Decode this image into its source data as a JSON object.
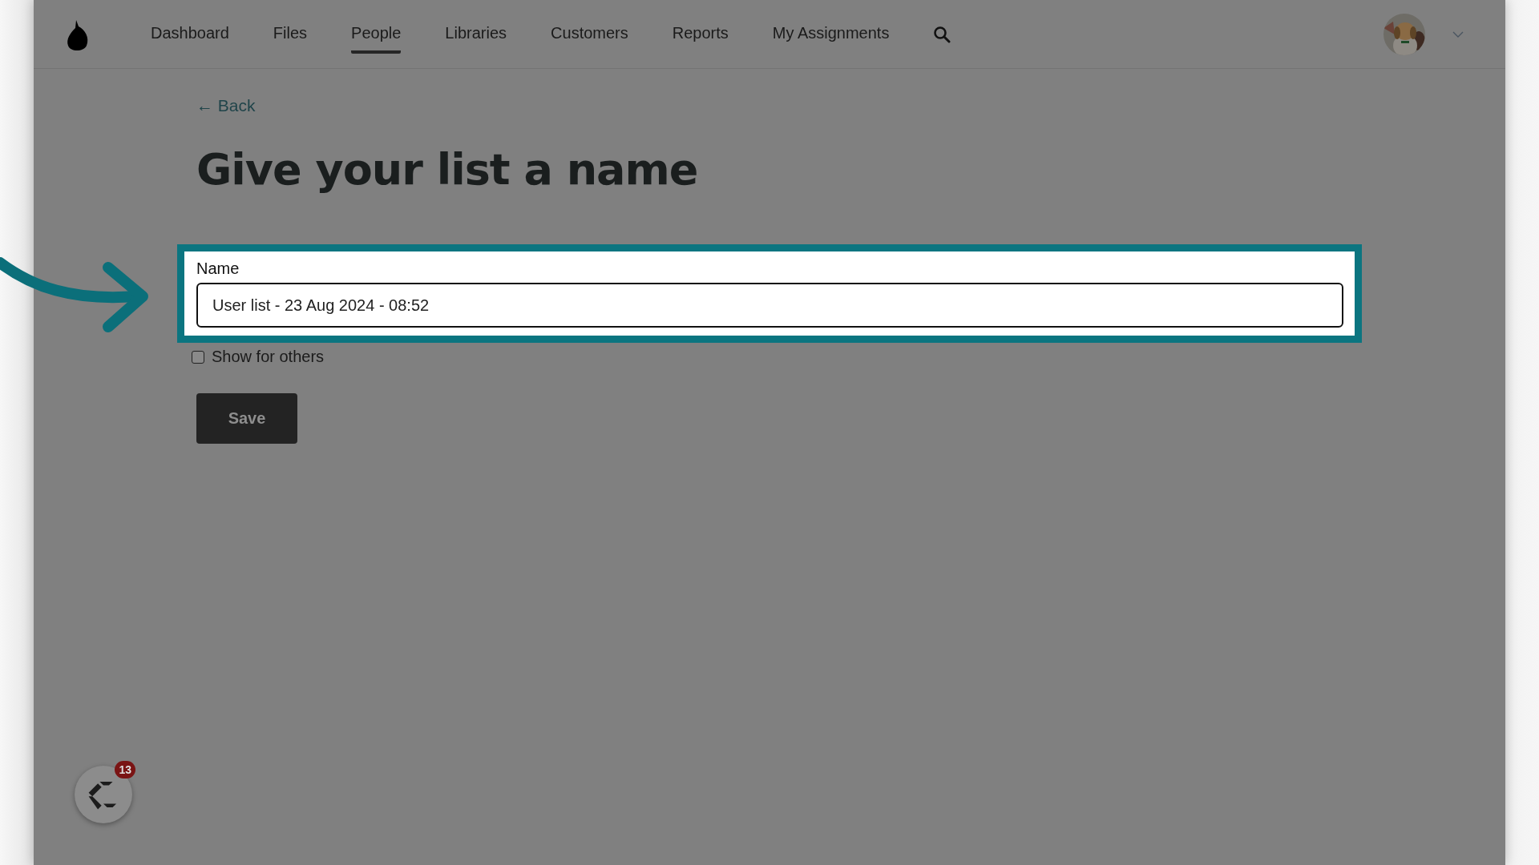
{
  "nav": {
    "items": [
      {
        "label": "Dashboard",
        "selected": false
      },
      {
        "label": "Files",
        "selected": false
      },
      {
        "label": "People",
        "selected": true
      },
      {
        "label": "Libraries",
        "selected": false
      },
      {
        "label": "Customers",
        "selected": false
      },
      {
        "label": "Reports",
        "selected": false
      },
      {
        "label": "My Assignments",
        "selected": false
      }
    ]
  },
  "back_link": "← Back",
  "title": "Give your list a name",
  "form": {
    "label": "Name",
    "value": "User list - 23 Aug 2024 - 08:52",
    "highlighted": true,
    "show_for_others": {
      "label": "Show for others",
      "checked": false
    },
    "save_button": "Save"
  },
  "widget": {
    "badge": "13"
  }
}
